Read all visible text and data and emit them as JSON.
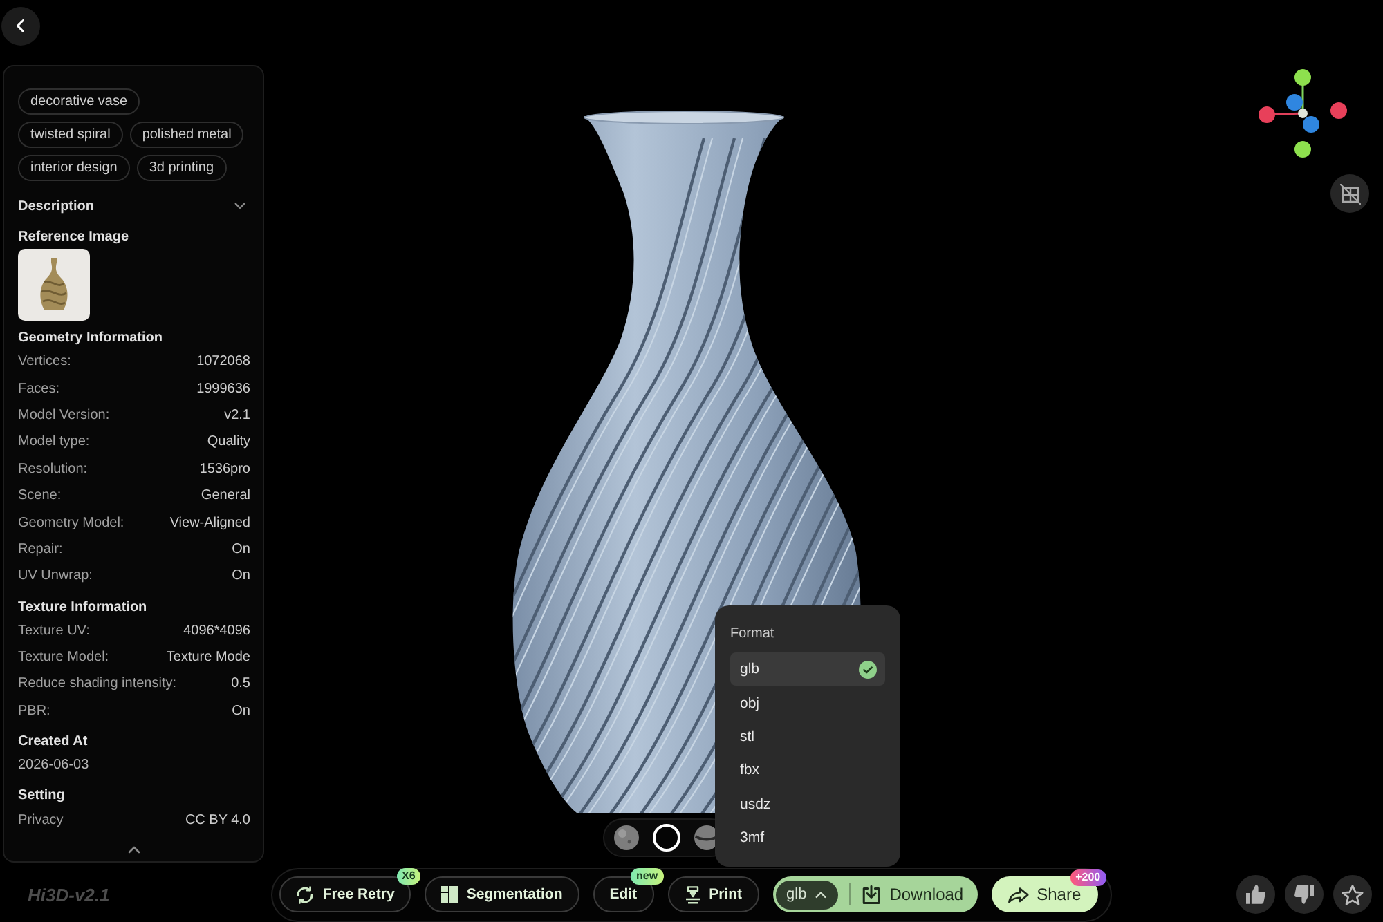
{
  "sidebar": {
    "tags": [
      "decorative vase",
      "twisted spiral",
      "polished metal",
      "interior design",
      "3d printing"
    ],
    "description": {
      "title": "Description",
      "expanded": false
    },
    "reference_image": {
      "title": "Reference Image"
    },
    "sections": [
      {
        "title": "Geometry Information",
        "rows": [
          {
            "label": "Vertices:",
            "value": "1072068"
          },
          {
            "label": "Faces:",
            "value": "1999636"
          },
          {
            "label": "Model Version:",
            "value": "v2.1"
          },
          {
            "label": "Model type:",
            "value": "Quality"
          },
          {
            "label": "Resolution:",
            "value": "1536pro"
          },
          {
            "label": "Scene:",
            "value": "General"
          },
          {
            "label": "Geometry Model:",
            "value": "View-Aligned"
          },
          {
            "label": "Repair:",
            "value": "On"
          },
          {
            "label": "UV Unwrap:",
            "value": "On"
          }
        ]
      },
      {
        "title": "Texture Information",
        "rows": [
          {
            "label": "Texture UV:",
            "value": "4096*4096"
          },
          {
            "label": "Texture Model:",
            "value": "Texture Mode"
          },
          {
            "label": "Reduce shading intensity:",
            "value": "0.5"
          },
          {
            "label": "PBR:",
            "value": "On"
          }
        ]
      },
      {
        "title": "Created At",
        "rows": [
          {
            "value": "2026-06-03"
          }
        ]
      },
      {
        "title": "Setting",
        "rows": [
          {
            "label": "Privacy",
            "value": "CC BY 4.0"
          }
        ]
      }
    ]
  },
  "viewport": {
    "view_modes": [
      {
        "kind": "solid",
        "selected": false
      },
      {
        "kind": "outline",
        "selected": true
      },
      {
        "kind": "banded",
        "selected": false
      }
    ]
  },
  "version_label": "Hi3D-v2.1",
  "toolbar": {
    "buttons": [
      {
        "label": "Free Retry",
        "kind": "retry",
        "badge": "X6"
      },
      {
        "label": "Segmentation",
        "kind": "segmentation"
      },
      {
        "label": "Edit",
        "kind": "edit",
        "badge": "new"
      },
      {
        "label": "Print",
        "kind": "print"
      }
    ],
    "format_button": {
      "label": "glb",
      "expanded": true
    },
    "download_button": {
      "label": "Download"
    },
    "share_button": {
      "label": "Share",
      "badge": "+200"
    }
  },
  "format_menu": {
    "title": "Format",
    "options": [
      {
        "label": "glb",
        "selected": true
      },
      {
        "label": "obj",
        "selected": false
      },
      {
        "label": "stl",
        "selected": false
      },
      {
        "label": "fbx",
        "selected": false
      },
      {
        "label": "usdz",
        "selected": false
      },
      {
        "label": "3mf",
        "selected": false
      }
    ]
  }
}
